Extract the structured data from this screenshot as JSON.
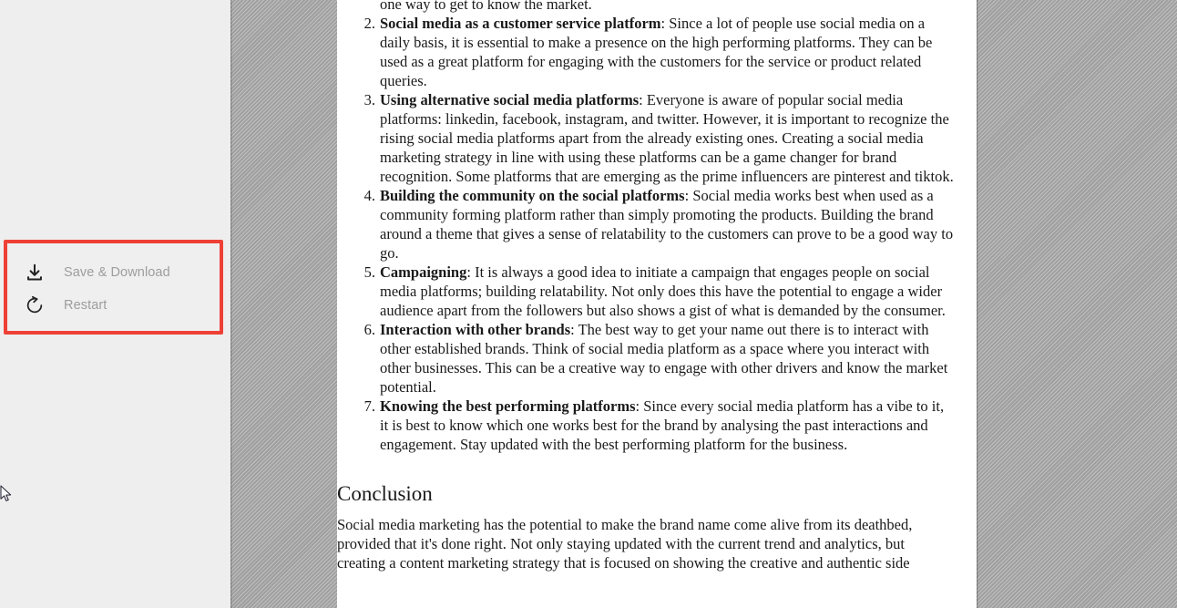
{
  "action_panel": {
    "items": [
      {
        "icon": "download-icon",
        "label": "Save & Download"
      },
      {
        "icon": "restart-icon",
        "label": "Restart"
      }
    ],
    "highlight_color": "#ee4036",
    "panel_background": "#efefef",
    "label_color": "#9d9d9d"
  },
  "document": {
    "continuation_line": "one way to get to know the market.",
    "list": [
      {
        "number": "2.",
        "term": "Social media as a customer service platform",
        "text": ": Since a lot of people use social media on a daily basis, it is essential to make a presence on the high performing platforms. They can be used as a great platform for engaging with the customers for the service or product related queries."
      },
      {
        "number": "3.",
        "term": "Using alternative social media platforms",
        "text": ": Everyone is aware of popular social media platforms: linkedin, facebook, instagram, and twitter. However, it is important to recognize the rising social media platforms apart from the already existing ones. Creating a social media marketing strategy in line with using these platforms can be a game changer for brand recognition. Some platforms that are emerging as the prime influencers are pinterest and tiktok."
      },
      {
        "number": "4.",
        "term": "Building the community on the social platforms",
        "text": ": Social media works best when used as a community forming platform rather than simply promoting the products. Building the brand around a theme that gives a sense of relatability to the customers can prove to be a good way to go."
      },
      {
        "number": "5.",
        "term": "Campaigning",
        "text": ": It is always a good idea to initiate a campaign that engages people on social media platforms; building relatability. Not only does this have the potential to engage a wider audience apart from the followers but also shows a gist of what is demanded by the consumer."
      },
      {
        "number": "6.",
        "term": "Interaction with other brands",
        "text": ": The best way to get your name out there is to interact with other established brands. Think of social media platform as a space where you interact with other businesses. This can be a creative way to engage with other drivers and know the market potential."
      },
      {
        "number": "7.",
        "term": "Knowing the best performing platforms",
        "text": ": Since every social media platform has a vibe to it, it is best to know which one works best for the brand by analysing the past interactions and engagement. Stay updated with the best performing platform for the business."
      }
    ],
    "conclusion_heading": "Conclusion",
    "conclusion_paragraph": "Social media marketing has the potential to make the brand name come alive from its deathbed, provided that it's done right. Not only staying updated with the current trend and analytics, but creating a content marketing strategy that is focused on showing the creative and authentic side"
  }
}
